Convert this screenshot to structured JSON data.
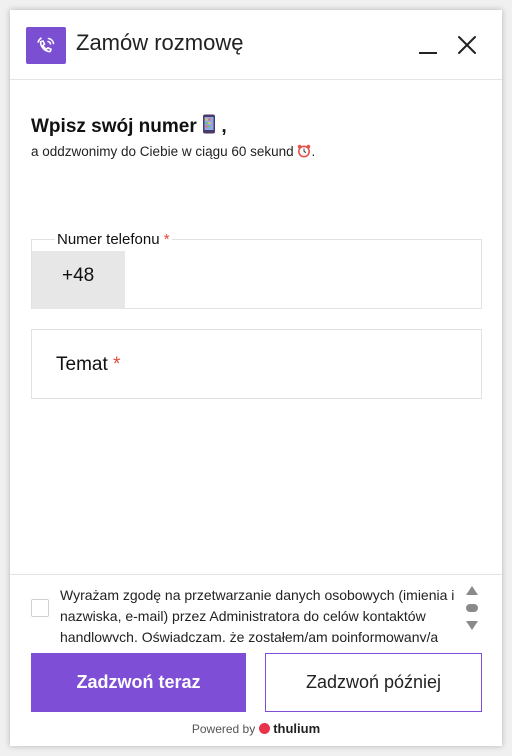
{
  "header": {
    "title": "Zamów rozmowę",
    "icon": "phone-ringing-icon",
    "accent": "#7b4fd1"
  },
  "intro": {
    "title": "Wpisz swój numer",
    "title_suffix": ",",
    "subtitle": "a oddzwonimy do Ciebie w ciągu 60 sekund",
    "subtitle_suffix": "."
  },
  "form": {
    "phone_label": "Numer telefonu",
    "phone_prefix": "+48",
    "phone_value": "",
    "topic_label": "Temat",
    "required_mark": "*"
  },
  "consent": {
    "text": "Wyrażam zgodę na przetwarzanie danych osobowych (imienia i nazwiska, e-mail) przez Administratora do celów kontaktów handlowych. Oświadczam, że zostałem/am poinformowany/a"
  },
  "buttons": {
    "call_now": "Zadzwoń teraz",
    "call_later": "Zadzwoń później"
  },
  "footer": {
    "powered_by": "Powered by",
    "brand": "thulium"
  },
  "colors": {
    "primary": "#7e4fd6",
    "required": "#e0483e",
    "brand_logo": "#e8334a"
  }
}
